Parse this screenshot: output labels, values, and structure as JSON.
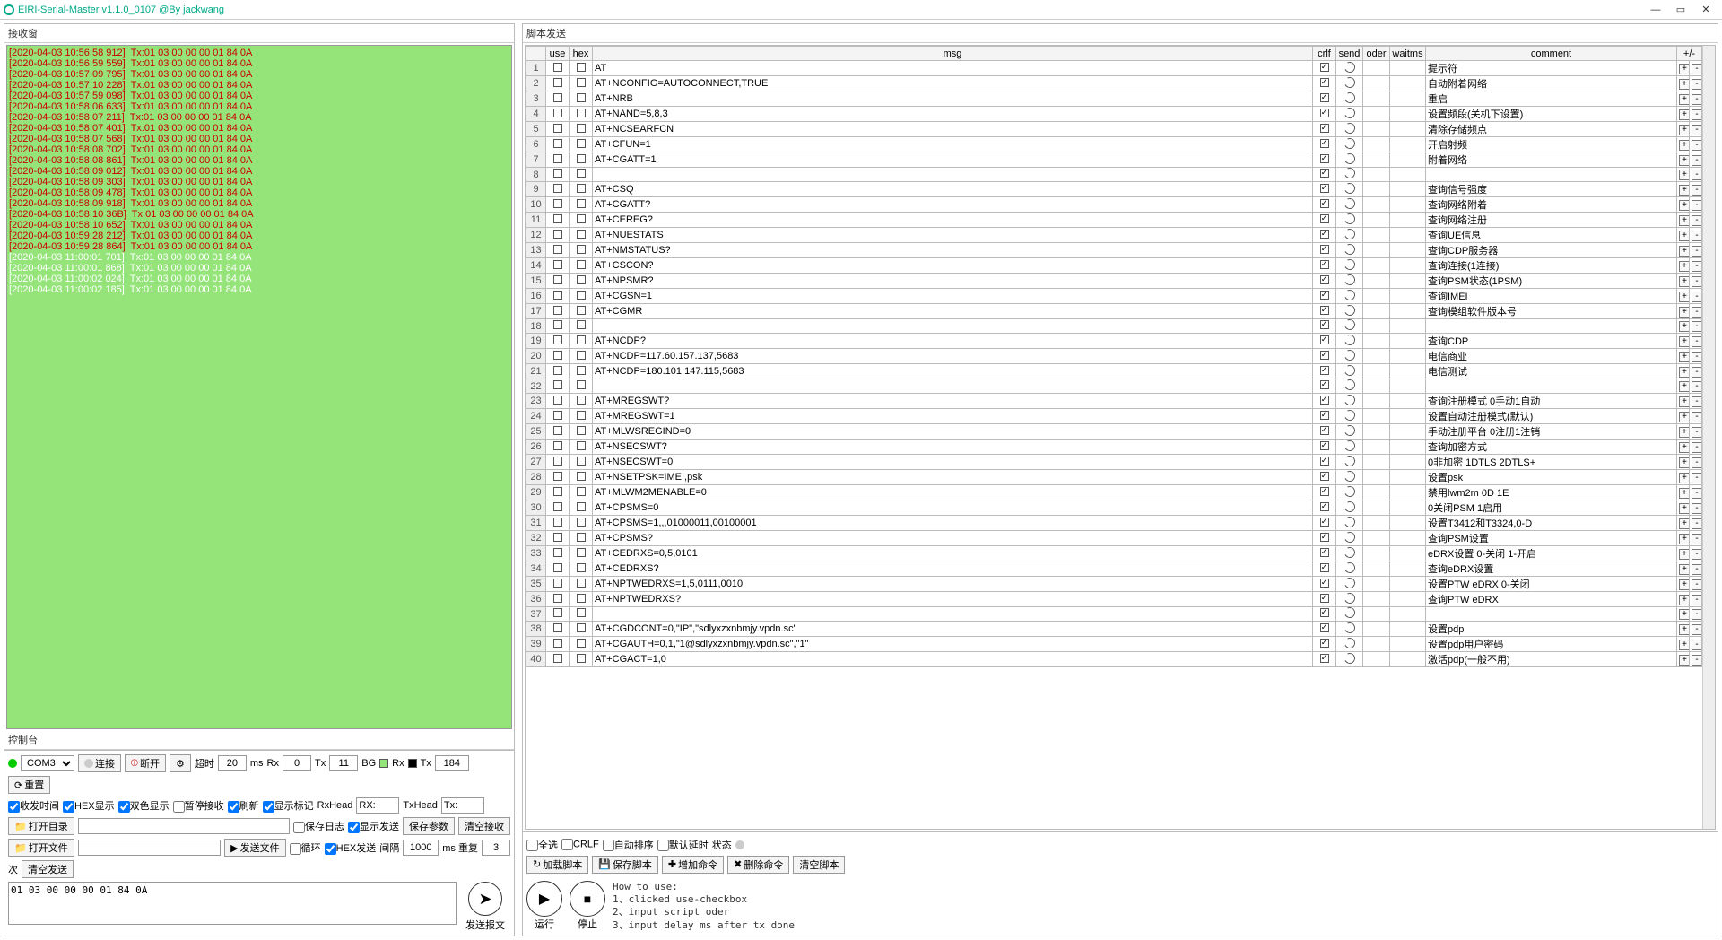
{
  "app": {
    "title": "EIRI-Serial-Master v1.1.0_0107 @By jackwang"
  },
  "win": {
    "min": "—",
    "max": "▭",
    "close": "✕"
  },
  "left_panel": {
    "title": "接收窗"
  },
  "recv_lines": [
    {
      "c": "red",
      "t": "[2020-04-03 10:56:58 912]  Tx:01 03 00 00 00 01 84 0A"
    },
    {
      "c": "red",
      "t": "[2020-04-03 10:56:59 559]  Tx:01 03 00 00 00 01 84 0A"
    },
    {
      "c": "red",
      "t": "[2020-04-03 10:57:09 795]  Tx:01 03 00 00 00 01 84 0A"
    },
    {
      "c": "red",
      "t": "[2020-04-03 10:57:10 228]  Tx:01 03 00 00 00 01 84 0A"
    },
    {
      "c": "red",
      "t": "[2020-04-03 10:57:59 098]  Tx:01 03 00 00 00 01 84 0A"
    },
    {
      "c": "red",
      "t": "[2020-04-03 10:58:06 633]  Tx:01 03 00 00 00 01 84 0A"
    },
    {
      "c": "red",
      "t": "[2020-04-03 10:58:07 211]  Tx:01 03 00 00 00 01 84 0A"
    },
    {
      "c": "red",
      "t": "[2020-04-03 10:58:07 401]  Tx:01 03 00 00 00 01 84 0A"
    },
    {
      "c": "red",
      "t": "[2020-04-03 10:58:07 568]  Tx:01 03 00 00 00 01 84 0A"
    },
    {
      "c": "red",
      "t": "[2020-04-03 10:58:08 702]  Tx:01 03 00 00 00 01 84 0A"
    },
    {
      "c": "red",
      "t": "[2020-04-03 10:58:08 861]  Tx:01 03 00 00 00 01 84 0A"
    },
    {
      "c": "red",
      "t": "[2020-04-03 10:58:09 012]  Tx:01 03 00 00 00 01 84 0A"
    },
    {
      "c": "red",
      "t": "[2020-04-03 10:58:09 303]  Tx:01 03 00 00 00 01 84 0A"
    },
    {
      "c": "red",
      "t": "[2020-04-03 10:58:09 478]  Tx:01 03 00 00 00 01 84 0A"
    },
    {
      "c": "red",
      "t": "[2020-04-03 10:58:09 918]  Tx:01 03 00 00 00 01 84 0A"
    },
    {
      "c": "red",
      "t": "[2020-04-03 10:58:10 36B]  Tx:01 03 00 00 00 01 84 0A"
    },
    {
      "c": "red",
      "t": "[2020-04-03 10:58:10 652]  Tx:01 03 00 00 00 01 84 0A"
    },
    {
      "c": "red",
      "t": "[2020-04-03 10:59:28 212]  Tx:01 03 00 00 00 01 84 0A"
    },
    {
      "c": "red",
      "t": "[2020-04-03 10:59:28 864]  Tx:01 03 00 00 00 01 84 0A"
    },
    {
      "c": "wht",
      "t": "[2020-04-03 11:00:01 701]  Tx:01 03 00 00 00 01 84 0A"
    },
    {
      "c": "wht",
      "t": "[2020-04-03 11:00:01 868]  Tx:01 03 00 00 00 01 84 0A"
    },
    {
      "c": "wht",
      "t": "[2020-04-03 11:00:02 024]  Tx:01 03 00 00 00 01 84 0A"
    },
    {
      "c": "wht",
      "t": "[2020-04-03 11:00:02 185]  Tx:01 03 00 00 00 01 84 0A"
    }
  ],
  "control_title": "控制台",
  "ctrl": {
    "port": "COM3",
    "connect": "连接",
    "disconnect": "断开",
    "timeout_lbl": "超时",
    "timeout": "20",
    "ms": "ms",
    "rx_lbl": "Rx",
    "rx_val": "0",
    "tx_lbl": "Tx",
    "tx_val": "11",
    "bg_lbl": "BG",
    "rx2_lbl": "Rx",
    "tx2_lbl": "Tx",
    "tx2_val": "184",
    "reset": "重置",
    "recvtime": "收发时间",
    "hexdisp": "HEX显示",
    "twocolor": "双色显示",
    "pauserecv": "暂停接收",
    "refresh": "刷新",
    "showmark": "显示标记",
    "rxhead": "RxHead",
    "rxhead_v": "RX:",
    "txhead": "TxHead",
    "txhead_v": "Tx:",
    "opendir": "打开目录",
    "openfile": "打开文件",
    "savelog": "保存日志",
    "showsend": "显示发送",
    "saveparam": "保存参数",
    "clearrecv": "清空接收",
    "sendfile": "发送文件",
    "loop": "循环",
    "hexsend": "HEX发送",
    "interval_lbl": "间隔",
    "interval": "1000",
    "ms_repeat": "ms 重复",
    "repeat": "3",
    "times": "次",
    "clearsend": "清空发送",
    "payload": "01 03 00 00 00 01 84 0A",
    "senddoc": "发送报文"
  },
  "right_title": "脚本发送",
  "headers": {
    "use": "use",
    "hex": "hex",
    "msg": "msg",
    "crlf": "crlf",
    "send": "send",
    "oder": "oder",
    "waitms": "waitms",
    "comment": "comment",
    "pm": "+/-"
  },
  "rows": [
    {
      "n": 1,
      "msg": "AT",
      "cmt": "提示符"
    },
    {
      "n": 2,
      "msg": "AT+NCONFIG=AUTOCONNECT,TRUE",
      "cmt": "自动附着网络"
    },
    {
      "n": 3,
      "msg": "AT+NRB",
      "cmt": "重启"
    },
    {
      "n": 4,
      "msg": "AT+NAND=5,8,3",
      "cmt": "设置频段(关机下设置)"
    },
    {
      "n": 5,
      "msg": "AT+NCSEARFCN",
      "cmt": "清除存储频点"
    },
    {
      "n": 6,
      "msg": "AT+CFUN=1",
      "cmt": "开启射频"
    },
    {
      "n": 7,
      "msg": "AT+CGATT=1",
      "cmt": "附着网络"
    },
    {
      "n": 8,
      "msg": "",
      "cmt": ""
    },
    {
      "n": 9,
      "msg": "AT+CSQ",
      "cmt": "查询信号强度"
    },
    {
      "n": 10,
      "msg": "AT+CGATT?",
      "cmt": "查询网络附着"
    },
    {
      "n": 11,
      "msg": "AT+CEREG?",
      "cmt": "查询网络注册"
    },
    {
      "n": 12,
      "msg": "AT+NUESTATS",
      "cmt": "查询UE信息"
    },
    {
      "n": 13,
      "msg": "AT+NMSTATUS?",
      "cmt": "查询CDP服务器"
    },
    {
      "n": 14,
      "msg": "AT+CSCON?",
      "cmt": "查询连接(1连接)"
    },
    {
      "n": 15,
      "msg": "AT+NPSMR?",
      "cmt": "查询PSM状态(1PSM)"
    },
    {
      "n": 16,
      "msg": "AT+CGSN=1",
      "cmt": "查询IMEI"
    },
    {
      "n": 17,
      "msg": "AT+CGMR",
      "cmt": "查询模组软件版本号"
    },
    {
      "n": 18,
      "msg": "",
      "cmt": ""
    },
    {
      "n": 19,
      "msg": "AT+NCDP?",
      "cmt": "查询CDP"
    },
    {
      "n": 20,
      "msg": "AT+NCDP=117.60.157.137,5683",
      "cmt": "电信商业"
    },
    {
      "n": 21,
      "msg": "AT+NCDP=180.101.147.115,5683",
      "cmt": "电信测试"
    },
    {
      "n": 22,
      "msg": "",
      "cmt": ""
    },
    {
      "n": 23,
      "msg": "AT+MREGSWT?",
      "cmt": "查询注册模式 0手动1自动"
    },
    {
      "n": 24,
      "msg": "AT+MREGSWT=1",
      "cmt": "设置自动注册模式(默认)"
    },
    {
      "n": 25,
      "msg": "AT+MLWSREGIND=0",
      "cmt": "手动注册平台 0注册1注销"
    },
    {
      "n": 26,
      "msg": "AT+NSECSWT?",
      "cmt": "查询加密方式"
    },
    {
      "n": 27,
      "msg": "AT+NSECSWT=0",
      "cmt": "0非加密 1DTLS 2DTLS+"
    },
    {
      "n": 28,
      "msg": "AT+NSETPSK=IMEI,psk",
      "cmt": "设置psk"
    },
    {
      "n": 29,
      "msg": "AT+MLWM2MENABLE=0",
      "cmt": "禁用lwm2m 0D 1E"
    },
    {
      "n": 30,
      "msg": "AT+CPSMS=0",
      "cmt": "0关闭PSM 1启用"
    },
    {
      "n": 31,
      "msg": "AT+CPSMS=1,,,01000011,00100001",
      "cmt": "设置T3412和T3324,0-D"
    },
    {
      "n": 32,
      "msg": "AT+CPSMS?",
      "cmt": "查询PSM设置"
    },
    {
      "n": 33,
      "msg": "AT+CEDRXS=0,5,0101",
      "cmt": "eDRX设置 0-关闭 1-开启"
    },
    {
      "n": 34,
      "msg": "AT+CEDRXS?",
      "cmt": "查询eDRX设置"
    },
    {
      "n": 35,
      "msg": "AT+NPTWEDRXS=1,5,0111,0010",
      "cmt": "设置PTW eDRX 0-关闭"
    },
    {
      "n": 36,
      "msg": "AT+NPTWEDRXS?",
      "cmt": "查询PTW eDRX"
    },
    {
      "n": 37,
      "msg": "",
      "cmt": ""
    },
    {
      "n": 38,
      "msg": "AT+CGDCONT=0,\"IP\",\"sdlyxzxnbmjy.vpdn.sc\"",
      "cmt": "设置pdp"
    },
    {
      "n": 39,
      "msg": "AT+CGAUTH=0,1,\"1@sdlyxzxnbmjy.vpdn.sc\",\"1\"",
      "cmt": "设置pdp用户密码"
    },
    {
      "n": 40,
      "msg": "AT+CGACT=1,0",
      "cmt": "激活pdp(一般不用)"
    }
  ],
  "lower": {
    "selall": "全选",
    "crlf": "CRLF",
    "autosort": "自动排序",
    "defdelay": "默认延时",
    "status": "状态",
    "loadscript": "加载脚本",
    "savescript": "保存脚本",
    "addcmd": "增加命令",
    "delcmd": "删除命令",
    "clearscript": "清空脚本",
    "run": "运行",
    "stop": "停止",
    "help": "How to use:\n1、clicked use-checkbox\n2、input script oder\n3、input delay ms after tx done"
  }
}
